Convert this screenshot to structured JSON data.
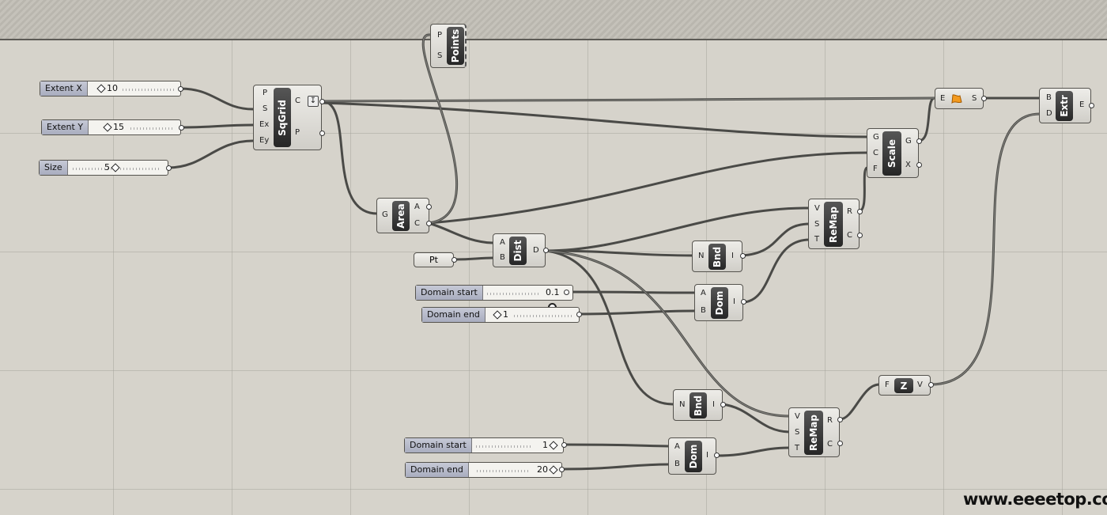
{
  "sliders": [
    {
      "label": "Extent X",
      "value": "10"
    },
    {
      "label": "Extent Y",
      "value": "15"
    },
    {
      "label": "Size",
      "value": "5"
    },
    {
      "label": "Domain start",
      "value": "0.1"
    },
    {
      "label": "Domain end",
      "value": "1"
    },
    {
      "label": "Domain start",
      "value": "1"
    },
    {
      "label": "Domain end",
      "value": "20"
    }
  ],
  "param_pt": {
    "label": "Pt"
  },
  "components": {
    "points": {
      "caption": "Points",
      "inputs": [
        "P",
        "S"
      ],
      "outputs": []
    },
    "sqgrid": {
      "caption": "SqGrid",
      "inputs": [
        "P",
        "S",
        "Ex",
        "Ey"
      ],
      "outputs": [
        "C",
        "P"
      ]
    },
    "area": {
      "caption": "Area",
      "inputs": [
        "G"
      ],
      "outputs": [
        "A",
        "C"
      ]
    },
    "dist": {
      "caption": "Dist",
      "inputs": [
        "A",
        "B"
      ],
      "outputs": [
        "D"
      ]
    },
    "bnd1": {
      "caption": "Bnd",
      "inputs": [
        "N"
      ],
      "outputs": [
        "I"
      ]
    },
    "dom1": {
      "caption": "Dom",
      "inputs": [
        "A",
        "B"
      ],
      "outputs": [
        "I"
      ]
    },
    "remap1": {
      "caption": "ReMap",
      "inputs": [
        "V",
        "S",
        "T"
      ],
      "outputs": [
        "R",
        "C"
      ]
    },
    "scale": {
      "caption": "Scale",
      "inputs": [
        "G",
        "C",
        "F"
      ],
      "outputs": [
        "G",
        "X"
      ]
    },
    "bnd2": {
      "caption": "Bnd",
      "inputs": [
        "N"
      ],
      "outputs": [
        "I"
      ]
    },
    "dom2": {
      "caption": "Dom",
      "inputs": [
        "A",
        "B"
      ],
      "outputs": [
        "I"
      ]
    },
    "remap2": {
      "caption": "ReMap",
      "inputs": [
        "V",
        "S",
        "T"
      ],
      "outputs": [
        "R",
        "C"
      ]
    },
    "zvec": {
      "caption": "Z",
      "inputs": [
        "F"
      ],
      "outputs": [
        "V"
      ]
    },
    "boundary": {
      "caption": "",
      "inputs": [
        "E"
      ],
      "outputs": [
        "S"
      ]
    },
    "extr": {
      "caption": "Extr",
      "inputs": [
        "B",
        "D"
      ],
      "outputs": [
        "E"
      ]
    }
  },
  "icons": {
    "dropdown": "arrow-down-icon",
    "boundary": "boundary-surface-icon"
  },
  "colors": {
    "canvas": "#d6d3cb",
    "wire": "#4a4a47",
    "caption": "#333333",
    "slider_label": "#b3b7c8"
  },
  "watermark": "www.eeeetop.com"
}
